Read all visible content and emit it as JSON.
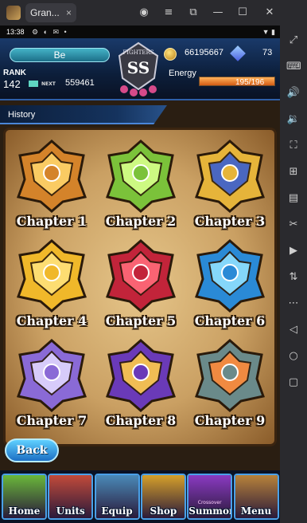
{
  "window": {
    "tab_title": "Gran...",
    "close_tab": "×"
  },
  "toolbar": {
    "icons": [
      "account-icon",
      "menu-icon",
      "restore-icon",
      "minimize-icon",
      "maximize-icon",
      "close-icon"
    ]
  },
  "sidebar": {
    "icons": [
      "expand-icon",
      "keyboard-icon",
      "volume-up-icon",
      "volume-down-icon",
      "fullscreen-icon",
      "add-icon",
      "apk-icon",
      "scissors-icon",
      "video-icon",
      "sync-icon",
      "more-icon",
      "back-icon",
      "home-icon",
      "recents-icon"
    ]
  },
  "status": {
    "time": "13:38",
    "icons": "⚙ ◐ ✉ •",
    "right": "▼ ▮"
  },
  "hud": {
    "player_name": "Be",
    "rank_label": "RANK",
    "rank_value": "142",
    "next_label": "NEXT",
    "next_value": "559461",
    "gold": "66195667",
    "gems": "73",
    "energy_label": "Energy",
    "energy_value": "195/196",
    "energy_fraction": 0.995
  },
  "history_label": "History",
  "chapters": [
    {
      "label": "Chapter 1",
      "color": "#d4832a",
      "accent": "#ffd36a"
    },
    {
      "label": "Chapter 2",
      "color": "#7bc23a",
      "accent": "#d6ff8a"
    },
    {
      "label": "Chapter 3",
      "color": "#e6b43a",
      "accent": "#3a5fd0"
    },
    {
      "label": "Chapter 4",
      "color": "#f0b82a",
      "accent": "#ffe27a"
    },
    {
      "label": "Chapter 5",
      "color": "#c2243a",
      "accent": "#ff6a7a"
    },
    {
      "label": "Chapter 6",
      "color": "#2a8ad6",
      "accent": "#8fe0ff"
    },
    {
      "label": "Chapter 7",
      "color": "#8a6ad6",
      "accent": "#e0d6ff"
    },
    {
      "label": "Chapter 8",
      "color": "#6a3ab8",
      "accent": "#ffcc4a"
    },
    {
      "label": "Chapter 9",
      "color": "#6a8a8a",
      "accent": "#ff8a3a"
    }
  ],
  "back_label": "Back",
  "nav": [
    {
      "label": "Home",
      "sub": "",
      "color": "#6ab83a"
    },
    {
      "label": "Units",
      "sub": "",
      "color": "#c24a3a"
    },
    {
      "label": "Equip",
      "sub": "",
      "color": "#4a8ab8"
    },
    {
      "label": "Shop",
      "sub": "",
      "color": "#d6a02a"
    },
    {
      "label": "Summon",
      "sub": "Crossover",
      "color": "#8a3ac2"
    },
    {
      "label": "Menu",
      "sub": "",
      "color": "#b8823a"
    }
  ]
}
